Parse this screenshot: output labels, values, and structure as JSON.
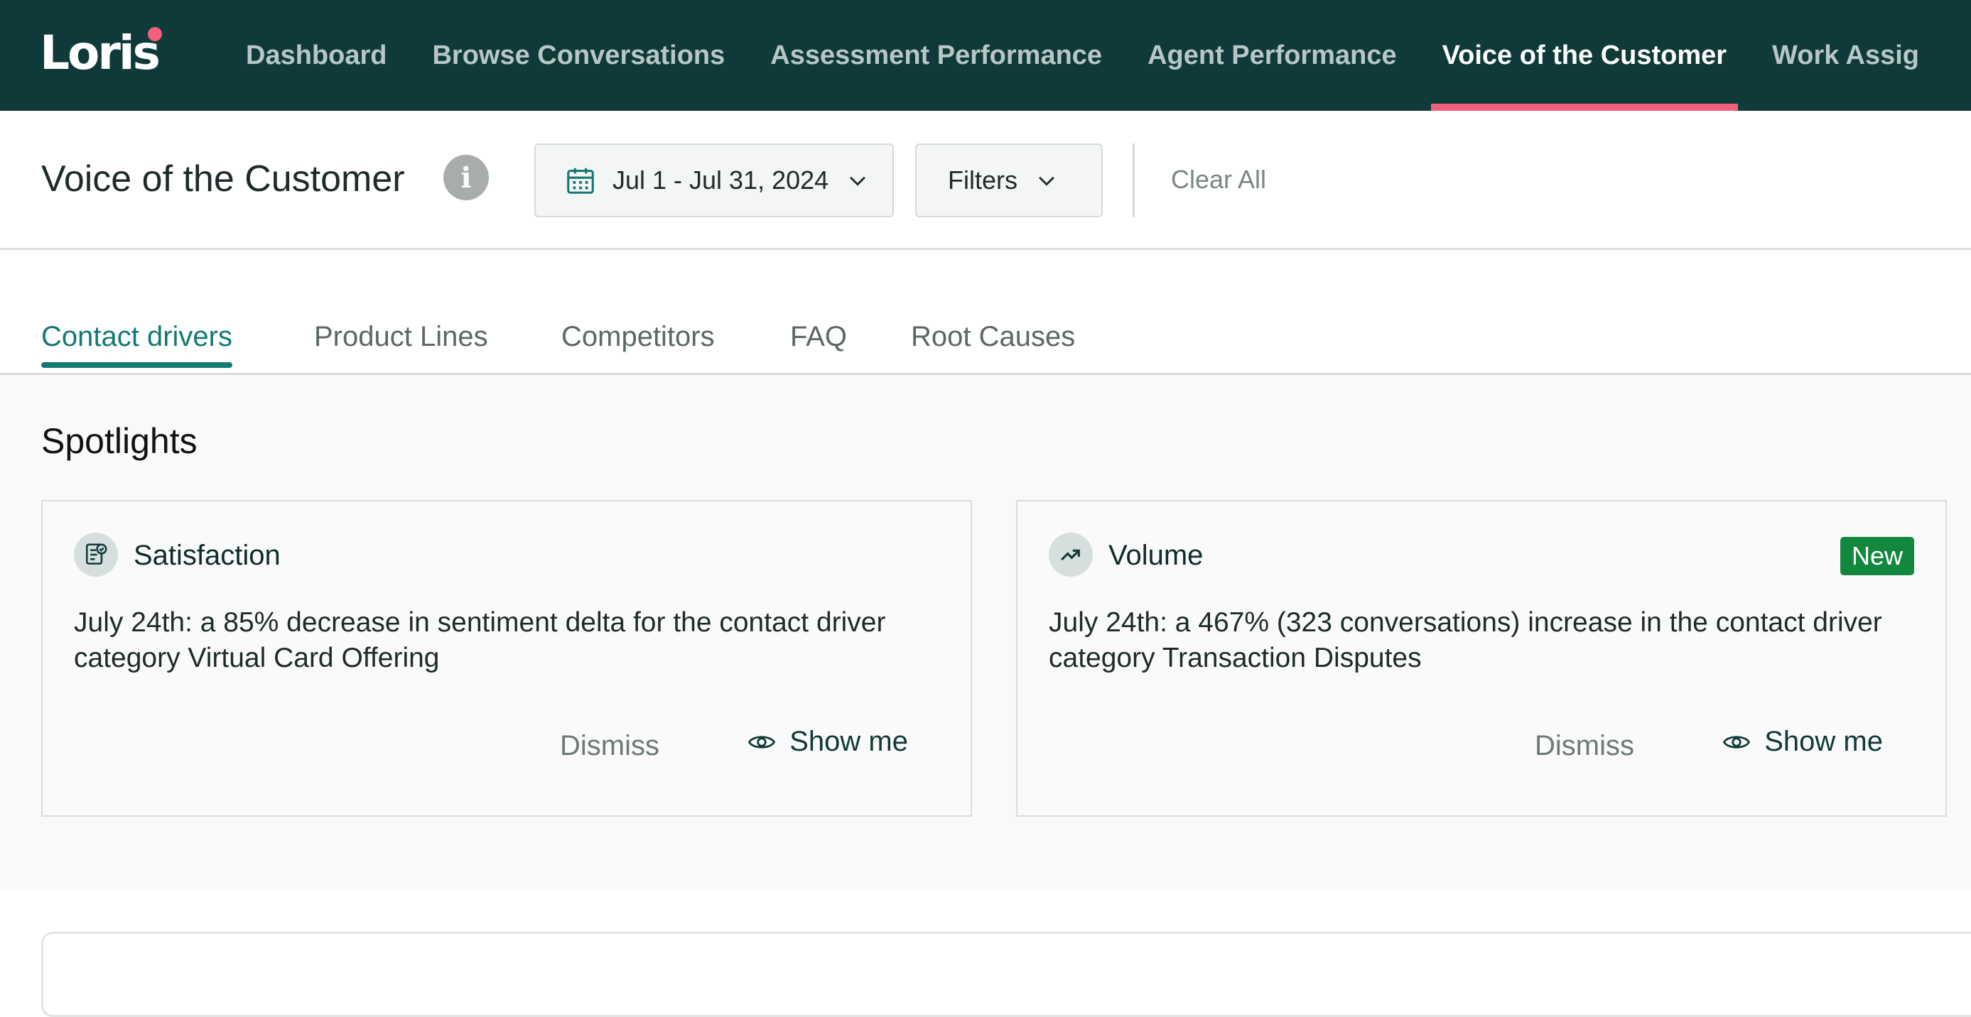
{
  "app": {
    "logo_text": "Loris"
  },
  "nav": {
    "items": [
      {
        "label": "Dashboard",
        "active": false
      },
      {
        "label": "Browse Conversations",
        "active": false
      },
      {
        "label": "Assessment Performance",
        "active": false
      },
      {
        "label": "Agent Performance",
        "active": false
      },
      {
        "label": "Voice of the Customer",
        "active": true
      },
      {
        "label": "Work Assig",
        "active": false
      }
    ]
  },
  "header": {
    "title": "Voice of the Customer",
    "info_glyph": "i",
    "date_range": "Jul 1 - Jul 31, 2024",
    "filters_label": "Filters",
    "clear_all": "Clear All"
  },
  "tabs": [
    {
      "label": "Contact drivers",
      "active": true
    },
    {
      "label": "Product Lines",
      "active": false
    },
    {
      "label": "Competitors",
      "active": false
    },
    {
      "label": "FAQ",
      "active": false
    },
    {
      "label": "Root Causes",
      "active": false
    }
  ],
  "spotlights": {
    "title": "Spotlights",
    "cards": [
      {
        "icon": "report-icon",
        "title": "Satisfaction",
        "badge": "",
        "description": "July 24th: a 85% decrease in sentiment delta for the contact driver category Virtual Card Offering",
        "dismiss_label": "Dismiss",
        "show_label": "Show me"
      },
      {
        "icon": "trending-up-icon",
        "title": "Volume",
        "badge": "New",
        "description": "July 24th: a 467% (323 conversations) increase in the contact driver category Transaction Disputes",
        "dismiss_label": "Dismiss",
        "show_label": "Show me"
      }
    ]
  },
  "colors": {
    "nav_bg": "#0f3a39",
    "nav_active_underline": "#f0607c",
    "tab_active": "#137a72",
    "badge_new": "#12883e"
  }
}
